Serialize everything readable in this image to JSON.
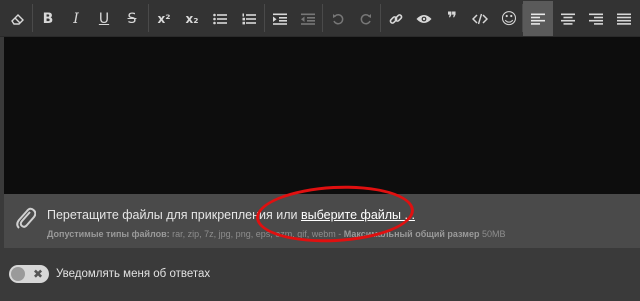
{
  "toolbar": {
    "icons": {
      "eraser": "eraser-icon",
      "bold": "B",
      "italic": "I",
      "underline": "U",
      "strike": "S",
      "superscript": "x²",
      "subscript": "x₂",
      "quote": "❞",
      "smile": "☺"
    }
  },
  "attach": {
    "prompt": "Перетащите файлы для прикрепления или",
    "link": "выберите файлы ...",
    "types_label": "Допустимые типы файлов:",
    "types": "rar, zip, 7z, jpg, png, eps, ezm, gif, webm",
    "separator": " - ",
    "max_label": "Максимальный общий размер",
    "max_value": "50MB"
  },
  "notify": {
    "label": "Уведомлять меня об ответах",
    "toggle_state": "off",
    "toggle_glyph": "✖"
  },
  "colors": {
    "toolbar": "#333333",
    "editor": "#0d0d0d",
    "attach_bar": "#4a4a4a",
    "page": "#3a3a3a",
    "annotation": "#e01010"
  }
}
